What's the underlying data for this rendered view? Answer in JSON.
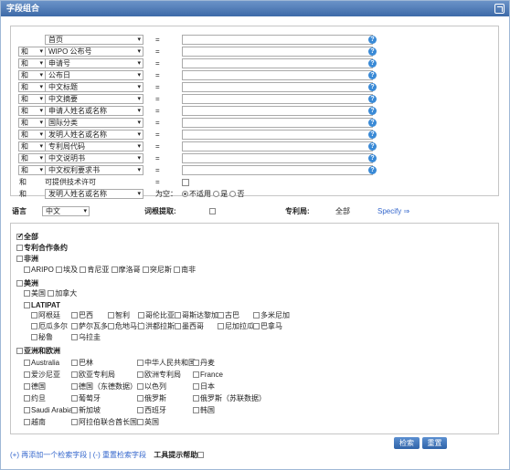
{
  "window": {
    "title": "字段组合"
  },
  "fields": [
    {
      "op": "",
      "field": "首页",
      "eq": "="
    },
    {
      "op": "和",
      "field": "WIPO 公布号",
      "eq": "="
    },
    {
      "op": "和",
      "field": "申请号",
      "eq": "="
    },
    {
      "op": "和",
      "field": "公布日",
      "eq": "="
    },
    {
      "op": "和",
      "field": "中文标题",
      "eq": "="
    },
    {
      "op": "和",
      "field": "中文摘要",
      "eq": "="
    },
    {
      "op": "和",
      "field": "申请人姓名或名称",
      "eq": "="
    },
    {
      "op": "和",
      "field": "国际分类",
      "eq": "="
    },
    {
      "op": "和",
      "field": "发明人姓名或名称",
      "eq": "="
    },
    {
      "op": "和",
      "field": "专利局代码",
      "eq": "="
    },
    {
      "op": "和",
      "field": "中文说明书",
      "eq": "="
    },
    {
      "op": "和",
      "field": "中文权利要求书",
      "eq": "="
    }
  ],
  "license_row": {
    "op": "和",
    "label": "可提供技术许可",
    "eq": "="
  },
  "inventor_row": {
    "op": "和",
    "field": "发明人姓名或名称",
    "eq": "为空：",
    "opt1": "不适用",
    "opt2": "是",
    "opt3": "否"
  },
  "lang_row": {
    "lang_label": "语言",
    "lang_value": "中文",
    "stem_label": "词根提取:",
    "office_label": "专利局:",
    "office_value": "全部",
    "specify": "Specify ⇒"
  },
  "offices": {
    "all": "全部",
    "pct": "专利合作条约",
    "africa": "非洲",
    "africa_items": [
      "ARIPO",
      "埃及",
      "肯尼亚",
      "摩洛哥",
      "突尼斯",
      "南非"
    ],
    "americas": "美洲",
    "americas_items": [
      "美国",
      "加拿大"
    ],
    "latipat": "LATIPAT",
    "latipat_items": [
      "阿根廷",
      "巴西",
      "智利",
      "哥伦比亚",
      "哥斯达黎加",
      "古巴",
      "多米尼加",
      "厄瓜多尔",
      "萨尔瓦多",
      "危地马拉",
      "洪都拉斯",
      "墨西哥",
      "尼加拉瓜",
      "巴拿马",
      "秘鲁",
      "乌拉圭"
    ],
    "asia": "亚洲和欧洲",
    "asia_items": [
      "Australia",
      "巴林",
      "中华人民共和国",
      "丹麦",
      "爱沙尼亚",
      "欧亚专利局",
      "欧洲专利局",
      "France",
      "德国",
      "德国（东德数据）",
      "以色列",
      "日本",
      "约旦",
      "葡萄牙",
      "俄罗斯",
      "俄罗斯（苏联数据）",
      "Saudi Arabia",
      "新加坡",
      "西班牙",
      "韩国",
      "越南",
      "阿拉伯联合酋长国",
      "英国"
    ]
  },
  "buttons": {
    "search": "检索",
    "reset": "重置"
  },
  "bottom": {
    "add": "(+) 再添加一个检索字段",
    "sep": " | ",
    "reduce": "(-) 重置检索字段",
    "help": "工具提示帮助"
  }
}
